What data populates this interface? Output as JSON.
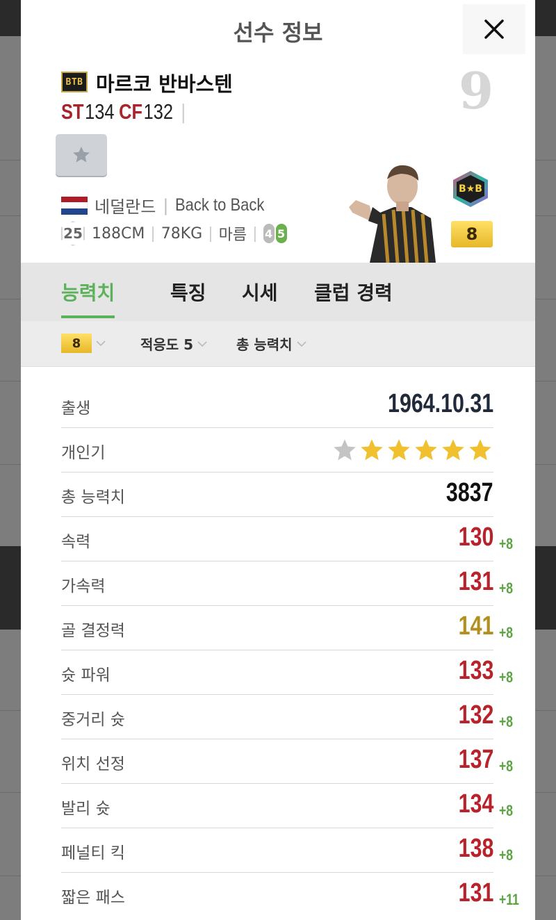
{
  "modal": {
    "title": "선수 정보"
  },
  "player": {
    "season_code": "BTB",
    "name": "마르코 반바스텐",
    "positions": [
      {
        "pos": "ST",
        "ovr": "134"
      },
      {
        "pos": "CF",
        "ovr": "132"
      }
    ],
    "jersey_number": "9",
    "nation": "네덜란드",
    "team": "Back to Back",
    "age": "25",
    "height": "188CM",
    "weight": "78KG",
    "body_type": "마름",
    "weak_foot": "4",
    "skill_moves": "5",
    "enhancement": "8",
    "season_emblem": "B★B"
  },
  "tabs": [
    {
      "label": "능력치",
      "active": true
    },
    {
      "label": "특징",
      "active": false
    },
    {
      "label": "시세",
      "active": false
    },
    {
      "label": "클럽 경력",
      "active": false
    }
  ],
  "filters": {
    "enhancement": "8",
    "adaptability": "적응도 5",
    "total_stats": "총 능력치"
  },
  "stats": [
    {
      "label": "출생",
      "value": "1964.10.31",
      "kind": "text"
    },
    {
      "label": "개인기",
      "kind": "stars",
      "filled": 5,
      "max": 6
    },
    {
      "label": "총 능력치",
      "value": "3837",
      "kind": "total"
    },
    {
      "label": "속력",
      "value": "130",
      "boost": "+8",
      "kind": "red"
    },
    {
      "label": "가속력",
      "value": "131",
      "boost": "+8",
      "kind": "red"
    },
    {
      "label": "골 결정력",
      "value": "141",
      "boost": "+8",
      "kind": "gold"
    },
    {
      "label": "슛 파워",
      "value": "133",
      "boost": "+8",
      "kind": "red"
    },
    {
      "label": "중거리 슛",
      "value": "132",
      "boost": "+8",
      "kind": "red"
    },
    {
      "label": "위치 선정",
      "value": "137",
      "boost": "+8",
      "kind": "red"
    },
    {
      "label": "발리 슛",
      "value": "134",
      "boost": "+8",
      "kind": "red"
    },
    {
      "label": "페널티 킥",
      "value": "138",
      "boost": "+8",
      "kind": "red"
    },
    {
      "label": "짧은 패스",
      "value": "131",
      "boost": "+11",
      "kind": "red"
    }
  ],
  "colors": {
    "accent_green": "#5bb25a",
    "stat_red": "#b8232b",
    "stat_gold": "#b38f1f",
    "star_gold": "#f0c02e",
    "star_gray": "#c4c4c4"
  }
}
